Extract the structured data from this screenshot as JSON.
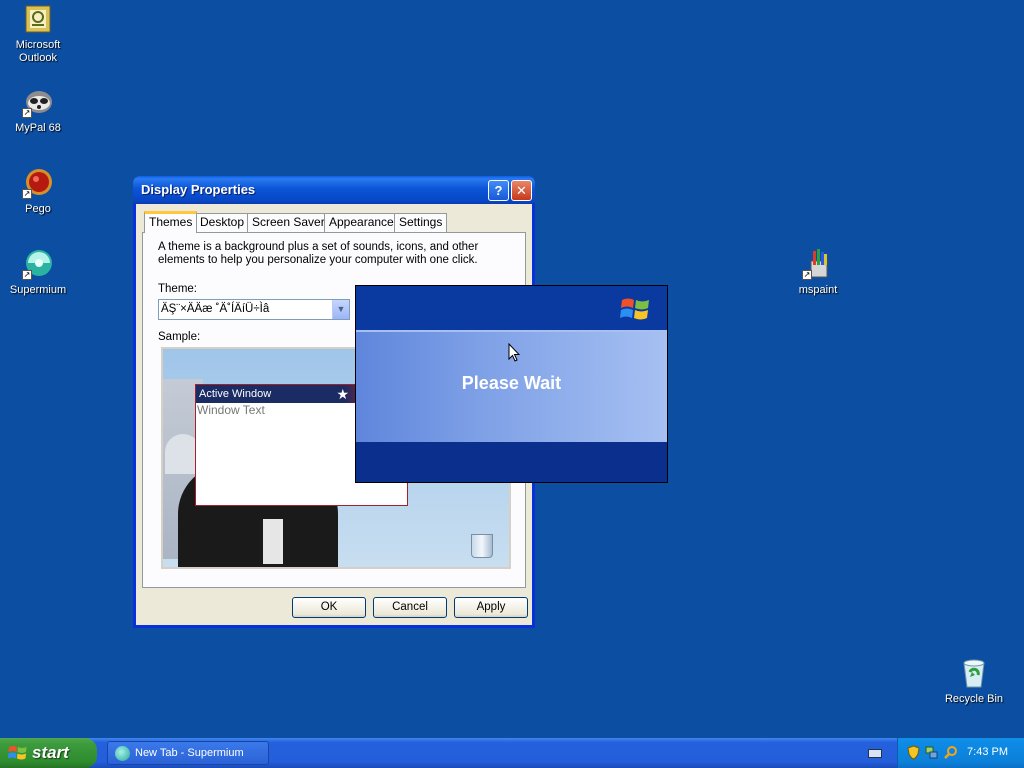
{
  "desktop": {
    "icons": [
      {
        "label": "Microsoft Outlook"
      },
      {
        "label": "MyPal 68"
      },
      {
        "label": "Pego"
      },
      {
        "label": "Supermium"
      },
      {
        "label": "mspaint"
      },
      {
        "label": "Recycle Bin"
      }
    ]
  },
  "dialog": {
    "title": "Display Properties",
    "help_glyph": "?",
    "close_glyph": "✕",
    "tabs": [
      "Themes",
      "Desktop",
      "Screen Saver",
      "Appearance",
      "Settings"
    ],
    "active_tab": "Themes",
    "description": "A theme is a background plus a set of sounds, icons, and other elements to help you personalize your computer with one click.",
    "theme_label": "Theme:",
    "theme_value": "ÄŞ¨×ÄÄæ ˚Ä˚ÍÄíÜ÷Ìâ",
    "sample_label": "Sample:",
    "sample_window_title": "Active Window",
    "sample_window_text": "Window Text",
    "buttons": {
      "ok": "OK",
      "cancel": "Cancel",
      "apply": "Apply"
    }
  },
  "splash": {
    "message": "Please Wait"
  },
  "taskbar": {
    "start_label": "start",
    "task_item": "New Tab - Supermium",
    "clock": "7:43 PM"
  },
  "colors": {
    "desktop": "#0b4ea2",
    "taskbar": "#245edb",
    "start": "#3c9b3c",
    "tray": "#0c80d9"
  }
}
